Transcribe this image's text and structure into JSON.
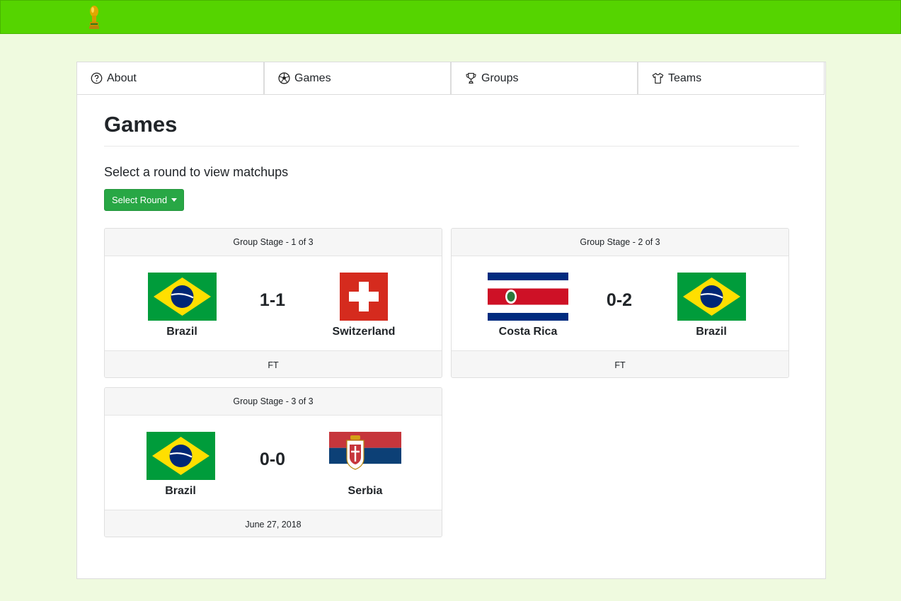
{
  "header": {
    "logo_icon": "trophy-icon",
    "brand_color": "#55d400"
  },
  "tabs": [
    {
      "label": "About",
      "icon": "question-circle-icon"
    },
    {
      "label": "Games",
      "icon": "soccer-ball-icon"
    },
    {
      "label": "Groups",
      "icon": "trophy-icon"
    },
    {
      "label": "Teams",
      "icon": "shirt-icon"
    }
  ],
  "page": {
    "title": "Games",
    "subtitle": "Select a round to view matchups",
    "select_round_label": "Select Round"
  },
  "games": [
    {
      "stage": "Group Stage - 1 of 3",
      "home": {
        "name": "Brazil",
        "flag": "brazil-flag"
      },
      "away": {
        "name": "Switzerland",
        "flag": "switzerland-flag"
      },
      "score": "1-1",
      "status": "FT"
    },
    {
      "stage": "Group Stage - 2 of 3",
      "home": {
        "name": "Costa Rica",
        "flag": "costa-rica-flag"
      },
      "away": {
        "name": "Brazil",
        "flag": "brazil-flag"
      },
      "score": "0-2",
      "status": "FT"
    },
    {
      "stage": "Group Stage - 3 of 3",
      "home": {
        "name": "Brazil",
        "flag": "brazil-flag"
      },
      "away": {
        "name": "Serbia",
        "flag": "serbia-flag"
      },
      "score": "0-0",
      "status": "June 27, 2018"
    }
  ]
}
